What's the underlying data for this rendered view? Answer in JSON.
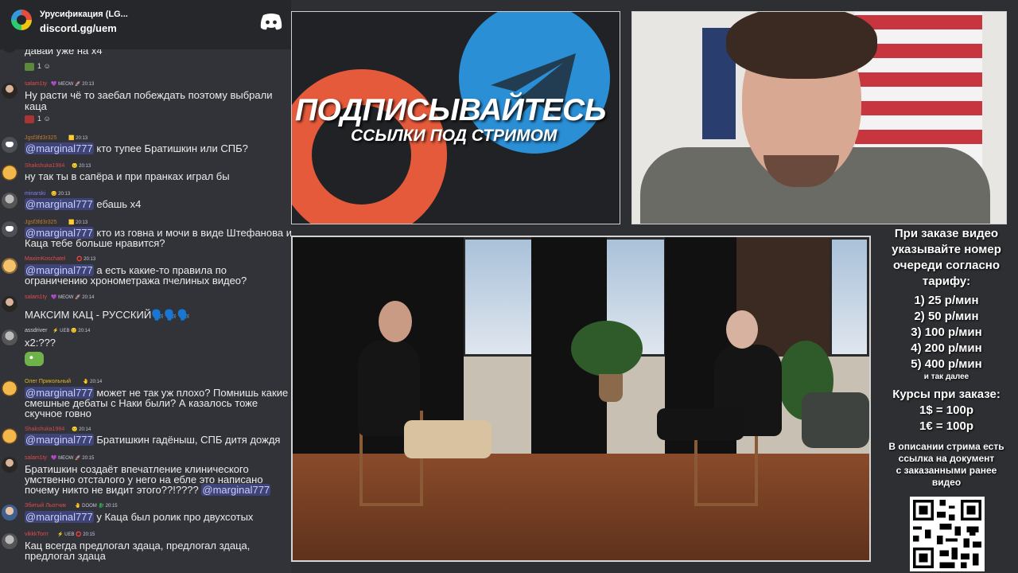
{
  "discord": {
    "server_name": "Урусификация (LG...",
    "invite": "discord.gg/uem"
  },
  "chat": {
    "top_fragment": "давай уже на x4",
    "messages": [
      {
        "user": "salam1ty",
        "user_color": "#e84a4a",
        "badges": "💜 MEOW 🚀 20:13",
        "text": "Ну расти чё то заебал побеждать поэтому выбрали",
        "text2": "каца",
        "reactions": "1"
      },
      {
        "user": "Jgsf3fd3r325",
        "user_color": "#c47a2c",
        "badges": "🟨 20:13",
        "mention": "@marginal777",
        "text": " кто тупее Братишкин или СПБ?"
      },
      {
        "user": "Shakshuka1984",
        "user_color": "#d64a4a",
        "badges": "😐 20:13",
        "text": "ну так ты в сапёра и при пранках играл бы"
      },
      {
        "user": "minarski",
        "user_color": "#7f7fff",
        "badges": "😊 20:13",
        "mention": "@marginal777",
        "text": " ебашь x4"
      },
      {
        "user": "Jgsf3fd3r325",
        "user_color": "#c47a2c",
        "badges": "🟨 20:13",
        "mention": "@marginal777",
        "text": " кто из говна и мочи в виде Штефанова и",
        "text2": "Каца тебе больше нравится?"
      },
      {
        "user": "MaximKoschatel",
        "user_color": "#e64a4a",
        "badges": "⭕ 20:13",
        "mention": "@marginal777",
        "text": " а есть какие-то правила по",
        "text2": "ограничению хронометража пчелиных видео?"
      },
      {
        "user": "salam1ty",
        "user_color": "#e84a4a",
        "badges": "💜 MEOW 🚀 20:14",
        "text": "МАКСИМ КАЦ - РУССКИЙ🗣️🗣️🗣️"
      },
      {
        "user": "assdriver",
        "user_color": "#d0d0d0",
        "badges": "⚡ UEB 😐 20:14",
        "text": "x2:???"
      },
      {
        "user": "Олег Прикольный",
        "user_color": "#e6b422",
        "badges": "🤚 20:14",
        "mention": "@marginal777",
        "text": " может не так уж плохо? Помнишь какие",
        "text2": "смешные дебаты с Наки были? А казалось тоже",
        "text3": "скучное говно"
      },
      {
        "user": "Shakshuka1984",
        "user_color": "#d64a4a",
        "badges": "😐 20:14",
        "mention": "@marginal777",
        "text": " Братишкин гадёныш, СПБ дитя дождя"
      },
      {
        "user": "salam1ty",
        "user_color": "#e84a4a",
        "badges": "💜 MEOW 🚀 20:15",
        "text": "Братишкин создаёт впечатление клинического",
        "text2": "умственно отсталого у него на ебле это написано",
        "text3": "почему никто не видит этого??!????",
        "mention3": "@marginal777"
      },
      {
        "user": "Збитый Льотчик",
        "user_color": "#e64a4a",
        "badges": "🤚 DOOM 🐉 20:15",
        "mention": "@marginal777",
        "text": " у Каца был ролик про двухсотых"
      },
      {
        "user": "vikkkTorrr",
        "user_color": "#e64a4a",
        "badges": "⚡ UEB ⭕ 20:15",
        "text": "Кац всегда предлогал здаца, предлогал здаца,",
        "text2": "предлогал здаца"
      }
    ]
  },
  "promo": {
    "title": "ПОДПИСЫВАЙТЕСЬ",
    "subtitle": "ССЫЛКИ ПОД СТРИМОМ",
    "patreon_color": "#e65a3c",
    "telegram_color": "#2b8fd6"
  },
  "info": {
    "heading_lines": [
      "При заказе видео",
      "указывайте номер",
      "очереди согласно",
      "тарифу:"
    ],
    "tariffs": [
      "1) 25 р/мин",
      "2) 50 р/мин",
      "3) 100 р/мин",
      "4) 200 р/мин",
      "5) 400 р/мин"
    ],
    "tariff_more": "и так далее",
    "courses_title": "Курсы при заказе:",
    "courses": [
      "1$ = 100р",
      "1€ = 100р"
    ],
    "desc_lines": [
      "В описании стрима есть",
      "ссылка на документ",
      "с заказанными ранее",
      "видео"
    ]
  },
  "colors": {
    "chat_bg": "#313338",
    "mention_bg": "#5865f2",
    "page_bg": "#2e2f33"
  }
}
